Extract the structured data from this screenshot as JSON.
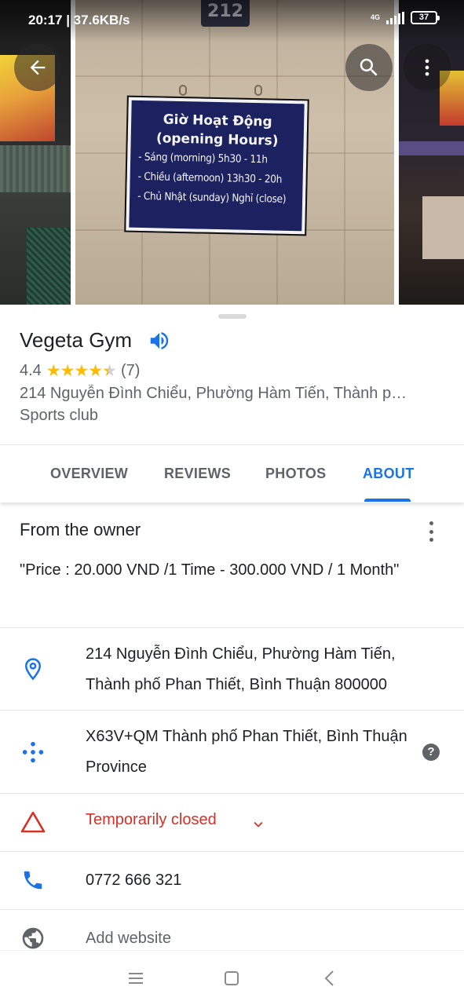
{
  "status_bar": {
    "time": "20:17 | 37.6KB/s",
    "network": "4G",
    "battery": "37"
  },
  "photo": {
    "house_number": "212",
    "sign_title_1": "Giờ Hoạt Động",
    "sign_title_2": "(opening Hours)",
    "sign_lines": [
      "- Sáng (morning)     5h30 - 11h",
      "- Chiều (afternoon) 13h30 - 20h",
      "- Chủ Nhật (sunday) Nghỉ (close)"
    ]
  },
  "place": {
    "name": "Vegeta Gym",
    "rating": "4.4",
    "stars": "★★★★",
    "review_count": "(7)",
    "address_short": "214 Nguyễn Đình Chiểu, Phường Hàm Tiến, Thành p…",
    "category": "Sports club"
  },
  "tabs": [
    "OVERVIEW",
    "REVIEWS",
    "PHOTOS",
    "ABOUT"
  ],
  "active_tab": "ABOUT",
  "owner": {
    "title": "From the owner",
    "text": "\"Price : 20.000 VND /1 Time - 300.000 VND / 1 Month\""
  },
  "details": {
    "address": "214 Nguyễn Đình Chiểu, Phường Hàm Tiến, Thành phố Phan Thiết, Bình Thuận 800000",
    "plus_code": "X63V+QM Thành phố Phan Thiết, Bình Thuận Province",
    "status": "Temporarily closed",
    "phone": "0772 666 321",
    "website": "Add website"
  },
  "colors": {
    "accent": "#1a73e8",
    "star": "#fbbc04",
    "closed": "#d93025",
    "text_secondary": "#5f6368"
  },
  "icons": {
    "back": "arrow-left-icon",
    "search": "search-icon",
    "more": "more-vert-icon",
    "speaker": "speaker-icon",
    "location": "location-pin-icon",
    "plus_code": "plus-code-icon",
    "closed": "warning-triangle-icon",
    "phone": "phone-icon",
    "website": "globe-icon",
    "help": "help-icon"
  }
}
